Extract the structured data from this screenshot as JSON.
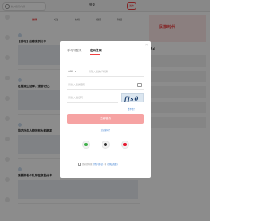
{
  "background": {
    "search_placeholder": "输入搜索内容",
    "top_links": [
      "登录",
      "发布"
    ],
    "nav_items": [
      "推荐",
      "关注",
      "热榜",
      "视频",
      "财经"
    ],
    "feed_titles": [
      "【参与】创意案例分享",
      "在星城生活季，漫游记忆",
      "国内外的人物的有大都都都",
      "我要带着个礼物在那里分享"
    ],
    "right_banner": "民族时代",
    "right_section": "热点"
  },
  "modal": {
    "close_label": "×",
    "tabs": [
      "手机号登录",
      "密码登录"
    ],
    "active_tab": 1,
    "phone_prefix": "+86",
    "phone_placeholder": "请输入您的手机号",
    "password_placeholder": "请输入您的密码",
    "captcha_placeholder": "请输入验证码",
    "captcha_text": "fjs0",
    "refresh_label": "看不清？",
    "login_label": "立即登录",
    "forgot_label": "忘记密码？",
    "social": [
      {
        "name": "wechat-icon",
        "color": "#3fb04b"
      },
      {
        "name": "qq-icon",
        "color": "#2f2f2f"
      },
      {
        "name": "weibo-icon",
        "color": "#e6162d"
      }
    ],
    "agreement_prefix": "登录即同意",
    "agreement_link1": "《用户协议》",
    "agreement_mid": "和",
    "agreement_link2": "《隐私政策》"
  }
}
